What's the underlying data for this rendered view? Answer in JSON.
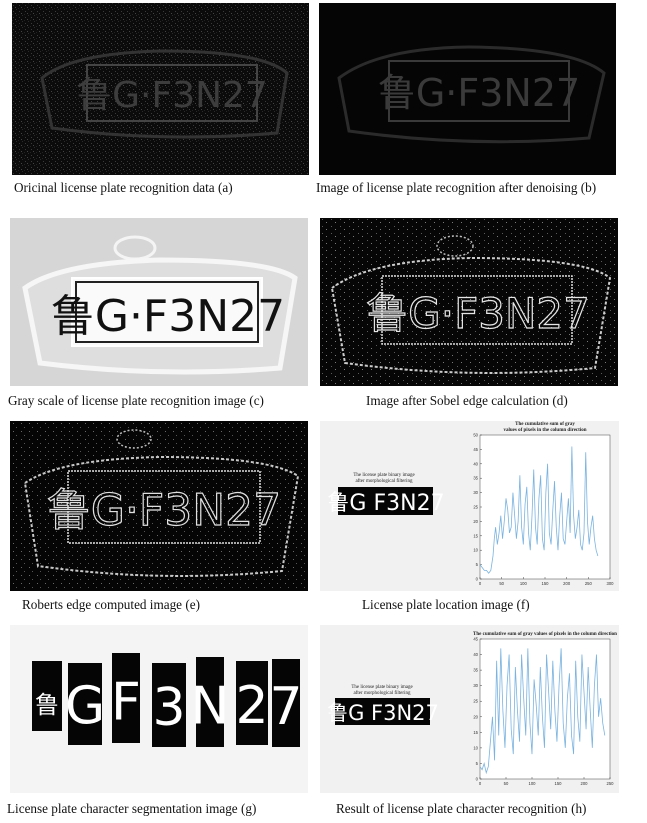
{
  "figure": {
    "panels": [
      {
        "id": "a",
        "caption": "Oricinal license plate recognition data (a)",
        "plate": "鲁G·F3N27"
      },
      {
        "id": "b",
        "caption": "Image of license plate recognition after denoising (b)",
        "plate": "鲁G·F3N27"
      },
      {
        "id": "c",
        "caption": "Gray scale of license plate recognition image (c)",
        "plate": "鲁G·F3N27"
      },
      {
        "id": "d",
        "caption": "Image after Sobel edge calculation (d)",
        "plate": "鲁G·F3N27"
      },
      {
        "id": "e",
        "caption": "Roberts edge computed image (e)",
        "plate": "鲁G·F3N27"
      },
      {
        "id": "f",
        "caption": "License plate location image (f)"
      },
      {
        "id": "g",
        "caption": "License plate character segmentation image (g)"
      },
      {
        "id": "h",
        "caption": "Result of license plate character recognition (h)"
      }
    ],
    "binary_label": [
      "The license plate binary image",
      "after morphological filtering"
    ],
    "binary_plate": "鲁G F3N27",
    "segments": [
      "鲁",
      "G",
      "F",
      "3",
      "N",
      "2",
      "7"
    ]
  },
  "chart_data": [
    {
      "type": "line",
      "title": [
        "The cumulative sum of gray",
        "values of pixels in the column direction"
      ],
      "xlim": [
        0,
        300
      ],
      "ylim": [
        0,
        50
      ],
      "xticks": [
        0,
        50,
        100,
        150,
        200,
        250,
        300
      ],
      "yticks": [
        0,
        5,
        10,
        15,
        20,
        25,
        30,
        35,
        40,
        45,
        50
      ],
      "color": "#7bb3e0",
      "series": [
        {
          "x": [
            0,
            5,
            10,
            15,
            20,
            25,
            30,
            33,
            36,
            40,
            44,
            48,
            52,
            56,
            60,
            64,
            68,
            72,
            76,
            80,
            84,
            88,
            92,
            96,
            100,
            104,
            108,
            112,
            116,
            120,
            124,
            128,
            132,
            136,
            140,
            144,
            148,
            152,
            156,
            160,
            164,
            168,
            172,
            176,
            180,
            184,
            188,
            192,
            196,
            200,
            204,
            208,
            212,
            216,
            220,
            224,
            228,
            232,
            236,
            240,
            244,
            248,
            252,
            256,
            260,
            264,
            268,
            272
          ],
          "y": [
            5,
            4,
            3,
            3,
            2,
            3,
            8,
            14,
            18,
            12,
            16,
            22,
            14,
            20,
            28,
            24,
            16,
            18,
            30,
            22,
            14,
            20,
            36,
            18,
            12,
            26,
            32,
            16,
            10,
            22,
            38,
            18,
            12,
            28,
            36,
            14,
            10,
            30,
            40,
            16,
            12,
            24,
            34,
            18,
            10,
            22,
            30,
            14,
            12,
            20,
            28,
            16,
            46,
            22,
            14,
            18,
            24,
            12,
            10,
            16,
            44,
            20,
            12,
            18,
            22,
            14,
            10,
            8
          ]
        }
      ]
    },
    {
      "type": "line",
      "title": [
        "The cumulative sum of gray values of pixels in the column direction"
      ],
      "xlim": [
        0,
        250
      ],
      "ylim": [
        0,
        45
      ],
      "xticks": [
        0,
        50,
        100,
        150,
        200,
        250
      ],
      "yticks": [
        0,
        5,
        10,
        15,
        20,
        25,
        30,
        35,
        40,
        45
      ],
      "color": "#7bb3e0",
      "series": [
        {
          "x": [
            0,
            4,
            8,
            12,
            16,
            20,
            24,
            28,
            32,
            36,
            40,
            44,
            48,
            52,
            56,
            60,
            64,
            68,
            72,
            76,
            80,
            84,
            88,
            92,
            96,
            100,
            104,
            108,
            112,
            116,
            120,
            124,
            128,
            132,
            136,
            140,
            144,
            148,
            152,
            156,
            160,
            164,
            168,
            172,
            176,
            180,
            184,
            188,
            192,
            196,
            200,
            204,
            208,
            212,
            216,
            220,
            224,
            228,
            232,
            236,
            240
          ],
          "y": [
            4,
            3,
            5,
            2,
            4,
            12,
            20,
            6,
            38,
            14,
            42,
            22,
            10,
            30,
            40,
            16,
            8,
            36,
            22,
            12,
            40,
            26,
            14,
            42,
            18,
            8,
            32,
            24,
            14,
            36,
            20,
            10,
            40,
            28,
            16,
            38,
            22,
            12,
            30,
            42,
            18,
            10,
            26,
            34,
            14,
            8,
            38,
            20,
            12,
            40,
            28,
            16,
            36,
            22,
            10,
            30,
            40,
            20,
            26,
            18,
            14
          ]
        }
      ]
    }
  ]
}
